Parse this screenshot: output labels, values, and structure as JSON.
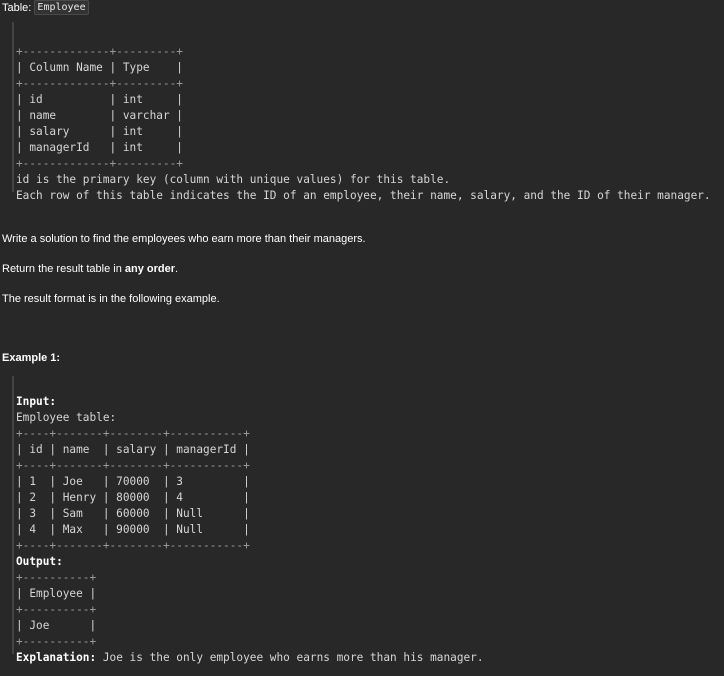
{
  "schema": {
    "label": "Table:",
    "table_name": "Employee",
    "border": "+-------------+---------+",
    "header_row": "| Column Name | Type    |",
    "rows": [
      "| id          | int     |",
      "| name        | varchar |",
      "| salary      | int     |",
      "| managerId   | int     |"
    ],
    "note_lines": [
      "id is the primary key (column with unique values) for this table.",
      "Each row of this table indicates the ID of an employee, their name, salary, and the ID of their manager."
    ]
  },
  "problem": {
    "statement": "Write a solution to find the employees who earn more than their managers.",
    "return_prefix": "Return the result table in ",
    "return_bold": "any order",
    "return_suffix": ".",
    "format_note": "The result format is in the following example."
  },
  "example": {
    "title": "Example 1:",
    "input_label": "Input:",
    "input_table_caption": "Employee table:",
    "input_border": "+----+-------+--------+-----------+",
    "input_header": "| id | name  | salary | managerId |",
    "input_rows": [
      "| 1  | Joe   | 70000  | 3         |",
      "| 2  | Henry | 80000  | 4         |",
      "| 3  | Sam   | 60000  | Null      |",
      "| 4  | Max   | 90000  | Null      |"
    ],
    "output_label": "Output:",
    "output_border": "+----------+",
    "output_header": "| Employee |",
    "output_rows": [
      "| Joe      |"
    ],
    "explanation_label": "Explanation:",
    "explanation_text": " Joe is the only employee who earns more than his manager."
  }
}
